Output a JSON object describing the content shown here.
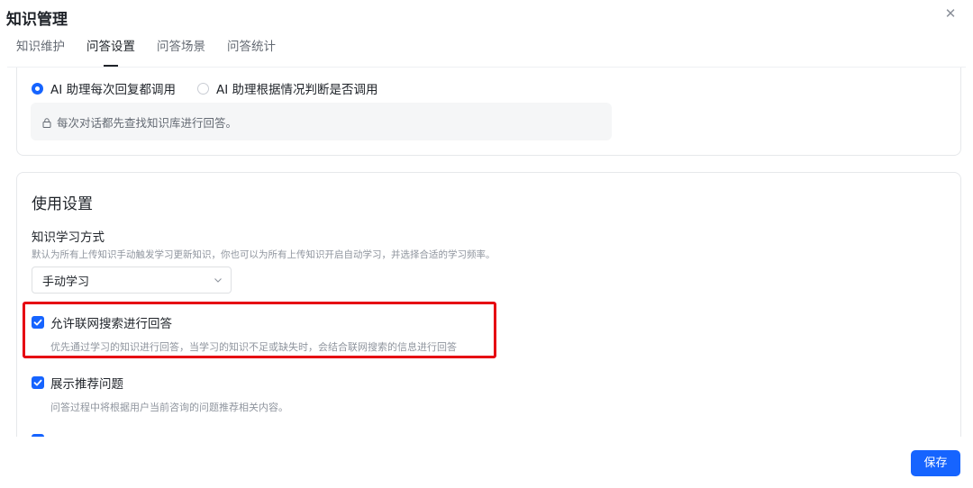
{
  "dialog": {
    "title": "知识管理"
  },
  "tabs": [
    {
      "label": "知识维护",
      "active": false
    },
    {
      "label": "问答设置",
      "active": true
    },
    {
      "label": "问答场景",
      "active": false
    },
    {
      "label": "问答统计",
      "active": false
    }
  ],
  "call_mode": {
    "options": [
      {
        "label": "AI 助理每次回复都调用",
        "checked": true
      },
      {
        "label": "AI 助理根据情况判断是否调用",
        "checked": false
      }
    ],
    "info": "每次对话都先查找知识库进行回答。"
  },
  "usage": {
    "section_title": "使用设置",
    "learning": {
      "title": "知识学习方式",
      "desc": "默认为所有上传知识手动触发学习更新知识，你也可以为所有上传知识开启自动学习，并选择合适的学习频率。",
      "selected": "手动学习"
    },
    "web_search": {
      "label": "允许联网搜索进行回答",
      "desc": "优先通过学习的知识进行回答，当学习的知识不足或缺失时，会结合联网搜索的信息进行回答",
      "checked": true
    },
    "recommend": {
      "label": "展示推荐问题",
      "desc": "问答过程中将根据用户当前咨询的问题推荐相关内容。",
      "checked": true
    }
  },
  "footer": {
    "save_label": "保存"
  },
  "colors": {
    "primary": "#1664ff",
    "highlight": "#e60012"
  }
}
